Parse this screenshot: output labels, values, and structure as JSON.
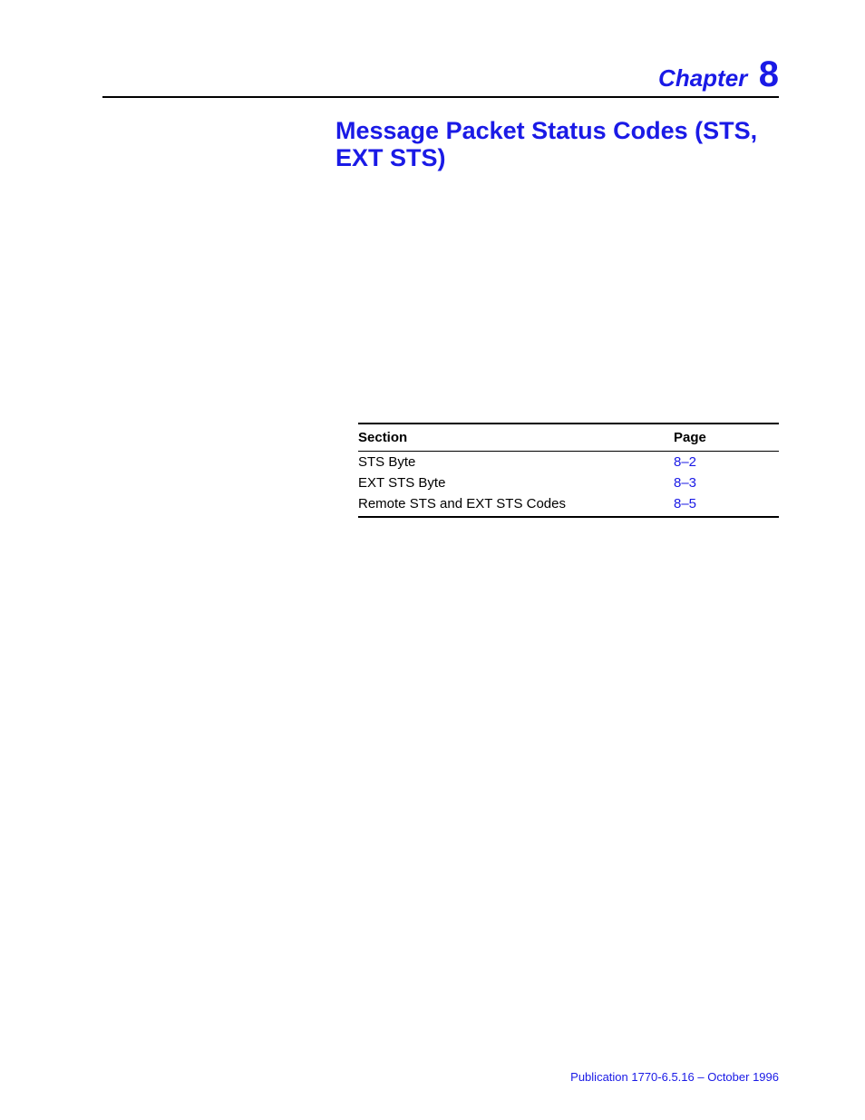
{
  "header": {
    "chapter_label": "Chapter",
    "chapter_number": "8"
  },
  "title": "Message Packet Status Codes (STS, EXT STS)",
  "toc": {
    "headers": {
      "section": "Section",
      "page": "Page"
    },
    "rows": [
      {
        "section": "STS Byte",
        "page": "8–2"
      },
      {
        "section": "EXT STS Byte",
        "page": "8–3"
      },
      {
        "section": "Remote STS and EXT STS Codes",
        "page": "8–5"
      }
    ]
  },
  "footer": "Publication 1770-6.5.16 – October 1996"
}
